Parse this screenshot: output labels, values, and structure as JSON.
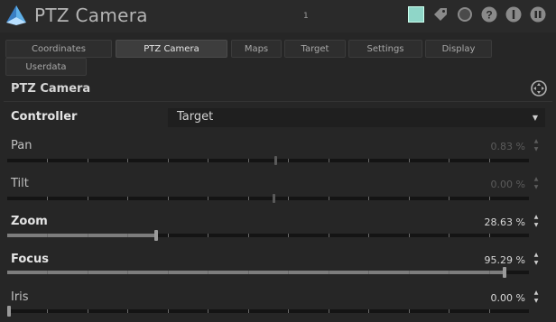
{
  "window": {
    "title": "PTZ Camera",
    "mini_mark": "1",
    "swatch_color": "#8fd6c8",
    "toolbar_icons": [
      "color-swatch-icon",
      "tag-icon",
      "record-icon",
      "help-icon",
      "info-icon",
      "pause-icon"
    ]
  },
  "tabs": [
    {
      "label": "Coordinates",
      "active": false
    },
    {
      "label": "PTZ Camera",
      "active": true
    },
    {
      "label": "Maps",
      "active": false
    },
    {
      "label": "Target",
      "active": false
    },
    {
      "label": "Settings",
      "active": false
    },
    {
      "label": "Display",
      "active": false
    },
    {
      "label": "Userdata",
      "active": false
    }
  ],
  "section": {
    "title": "PTZ Camera",
    "icon": "move-icon"
  },
  "controller": {
    "label": "Controller",
    "value": "Target",
    "arrow_icon": "dropdown-arrow-icon"
  },
  "sliders": [
    {
      "label": "Pan",
      "value_text": "0.83 %",
      "value": 0.0083,
      "enabled": false,
      "bold": false
    },
    {
      "label": "Tilt",
      "value_text": "0.00 %",
      "value": 0.0,
      "enabled": false,
      "bold": false
    },
    {
      "label": "Zoom",
      "value_text": "28.63 %",
      "value": 0.2863,
      "enabled": true,
      "bold": true
    },
    {
      "label": "Focus",
      "value_text": "95.29 %",
      "value": 0.9529,
      "enabled": true,
      "bold": true
    },
    {
      "label": "Iris",
      "value_text": "0.00 %",
      "value": 0.0,
      "enabled": true,
      "bold": false
    }
  ]
}
